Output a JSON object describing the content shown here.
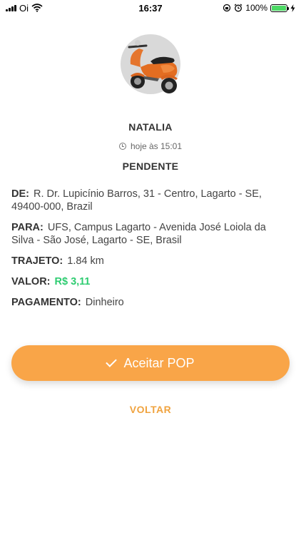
{
  "status_bar": {
    "carrier": "Oi",
    "time": "16:37",
    "battery_percent": "100%"
  },
  "trip": {
    "passenger_name": "NATALIA",
    "time_label": "hoje às 15:01",
    "status": "PENDENTE"
  },
  "details": {
    "from_label": "DE:",
    "from_value": "R. Dr. Lupicínio Barros, 31 - Centro, Lagarto - SE, 49400-000, Brazil",
    "to_label": "PARA:",
    "to_value": "UFS, Campus Lagarto - Avenida José Loiola da Silva - São José, Lagarto - SE, Brasil",
    "route_label": "TRAJETO:",
    "route_value": "1.84 km",
    "price_label": "VALOR:",
    "price_value": "R$ 3,11",
    "payment_label": "PAGAMENTO:",
    "payment_value": "Dinheiro"
  },
  "actions": {
    "accept_label": "Aceitar POP",
    "back_label": "VOLTAR"
  },
  "colors": {
    "accent": "#f9a548",
    "price_green": "#2ecc71",
    "link_orange": "#f0a33f"
  },
  "icons": [
    "signal-icon",
    "wifi-icon",
    "lock-rotation-icon",
    "alarm-icon",
    "battery-icon",
    "charging-icon",
    "scooter-icon",
    "clock-icon",
    "check-icon"
  ]
}
